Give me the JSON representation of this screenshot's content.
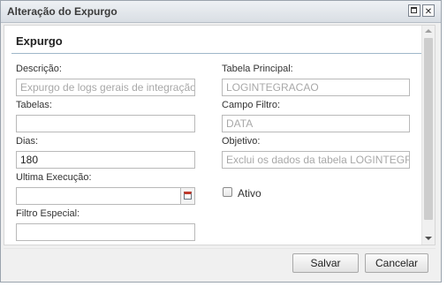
{
  "window": {
    "title": "Alteração do Expurgo",
    "icons": [
      "maximize-icon",
      "close-icon"
    ]
  },
  "section": {
    "title": "Expurgo"
  },
  "form": {
    "descricao": {
      "label": "Descrição:",
      "value": "Expurgo de logs gerais de integração"
    },
    "tabelas": {
      "label": "Tabelas:",
      "value": ""
    },
    "dias": {
      "label": "Dias:",
      "value": "180"
    },
    "ultima_execucao": {
      "label": "Ultima Execução:",
      "value": ""
    },
    "filtro_especial": {
      "label": "Filtro Especial:",
      "value": ""
    },
    "tabela_principal": {
      "label": "Tabela Principal:",
      "value": "LOGINTEGRACAO"
    },
    "campo_filtro": {
      "label": "Campo Filtro:",
      "value": "DATA"
    },
    "objetivo": {
      "label": "Objetivo:",
      "value": "Exclui os dados da tabela LOGINTEGRACAO"
    },
    "ativo": {
      "label": "Ativo",
      "checked": false
    }
  },
  "buttons": {
    "save": "Salvar",
    "cancel": "Cancelar"
  }
}
